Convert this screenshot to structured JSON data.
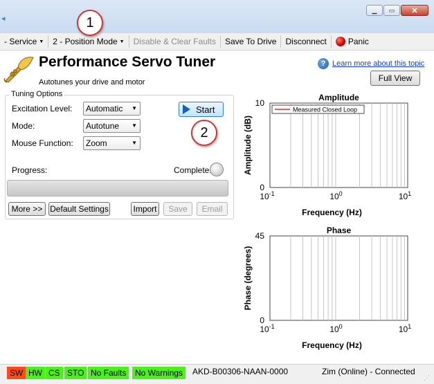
{
  "toolbar": {
    "service_label": "- Service",
    "position_mode_label": "2 - Position Mode",
    "disable_clear_label": "Disable & Clear Faults",
    "save_to_drive_label": "Save To Drive",
    "disconnect_label": "Disconnect",
    "panic_label": "Panic"
  },
  "callouts": [
    "1",
    "2"
  ],
  "header": {
    "title": "Performance Servo Tuner",
    "subtitle": "Autotunes your drive and motor",
    "help_link": "Learn more about this topic",
    "full_view_label": "Full View"
  },
  "tuning": {
    "group_title": "Tuning Options",
    "excitation_label": "Excitation Level:",
    "excitation_value": "Automatic",
    "mode_label": "Mode:",
    "mode_value": "Autotune",
    "mouse_label": "Mouse Function:",
    "mouse_value": "Zoom",
    "start_label": "Start",
    "progress_label": "Progress:",
    "progress_value": 0,
    "complete_label": "Complete:",
    "more_label": "More >>",
    "default_settings_label": "Default Settings",
    "import_label": "Import",
    "save_label": "Save",
    "email_label": "Email"
  },
  "status": {
    "badges": [
      {
        "label": "SW",
        "color": "#ff4a1c"
      },
      {
        "label": "HW",
        "color": "#4cf01a"
      },
      {
        "label": "CS",
        "color": "#4cf01a"
      },
      {
        "label": "STO",
        "color": "#4cf01a"
      },
      {
        "label": "No Faults",
        "color": "#4cf01a"
      },
      {
        "label": "No Warnings",
        "color": "#4cf01a"
      }
    ],
    "drive": "AKD-B00306-NAAN-0000",
    "connection": "Zim (Online) - Connected"
  },
  "chart_data": [
    {
      "type": "line",
      "title": "Amplitude",
      "ylabel": "Amplitude (dB)",
      "xlabel": "Frequency (Hz)",
      "x_scale": "log",
      "xlim": [
        0.1,
        10
      ],
      "ylim": [
        0,
        10
      ],
      "y_ticks": [
        "0",
        "10"
      ],
      "legend": "Measured Closed Loop",
      "legend_placement": "top-left",
      "series_color": "#cc0000",
      "grid": true
    },
    {
      "type": "line",
      "title": "Phase",
      "ylabel": "Phase (degrees)",
      "xlabel": "Frequency (Hz)",
      "x_scale": "log",
      "xlim": [
        0.1,
        10
      ],
      "ylim": [
        0,
        45
      ],
      "y_ticks": [
        "0",
        "45"
      ],
      "grid": true
    }
  ]
}
